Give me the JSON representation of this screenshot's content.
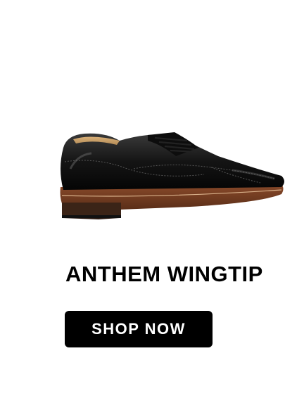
{
  "product": {
    "name": "ANTHEM WINGTIP",
    "image_icon": "wingtip-shoe-image",
    "cta_label": "SHOP NOW"
  },
  "colors": {
    "background": "#ffffff",
    "button_bg": "#000000",
    "button_text": "#ffffff",
    "title_text": "#000000"
  }
}
